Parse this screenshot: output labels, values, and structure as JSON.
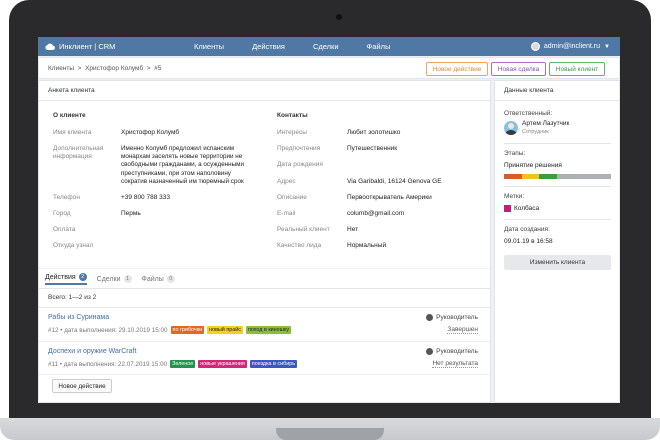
{
  "topbar": {
    "brand": "Инклиент | CRM",
    "nav": [
      "Клиенты",
      "Действия",
      "Сделки",
      "Файлы"
    ],
    "user": "admin@inclient.ru"
  },
  "breadcrumb": "Клиенты  >  Христофор Колумб  >  #5",
  "actions": {
    "new_action": "Новое действие",
    "new_deal": "Новая сделка",
    "new_client": "Новый клиент"
  },
  "profile": {
    "header": "Анкета клиента",
    "about_title": "О клиенте",
    "contacts_title": "Контакты",
    "left": [
      {
        "label": "Имя клиента",
        "value": "Христофор Колумб"
      },
      {
        "label": "Дополнительная информация",
        "value": "Именно Колумб предложил испанским монархам заселять новые территории не свободными гражданами, а осужденными преступниками, при этом наполовину сократив назначенный им тюремный срок"
      },
      {
        "label": "Телефон",
        "value": "+39 800 788 333"
      },
      {
        "label": "Город",
        "value": "Пермь"
      },
      {
        "label": "Оплата",
        "value": ""
      },
      {
        "label": "Откуда узнал",
        "value": ""
      }
    ],
    "right": [
      {
        "label": "Интересы",
        "value": "Любит золотишко"
      },
      {
        "label": "Предпочтения",
        "value": "Путешественник"
      },
      {
        "label": "Дата рождения",
        "value": ""
      },
      {
        "label": "Адрес",
        "value": "Via Garibaldi, 16124 Genova GE"
      },
      {
        "label": "Описание",
        "value": "Первооткрыватель Америки"
      },
      {
        "label": "E-mail",
        "value": "columb@gmail.com"
      },
      {
        "label": "Реальный клиент",
        "value": "Нет"
      },
      {
        "label": "Качество лида",
        "value": "Нормальный"
      }
    ]
  },
  "tabs": [
    {
      "label": "Действия",
      "count": "2"
    },
    {
      "label": "Сделки",
      "count": "1"
    },
    {
      "label": "Файлы",
      "count": "0"
    }
  ],
  "total": "Всего: 1—2 из 2",
  "deals": [
    {
      "title": "Рабы из Суринама",
      "meta": "#12 • дата выполнения: 29.10.2019 15:00",
      "tags": [
        {
          "text": "по грибочки",
          "color": "#e0681f"
        },
        {
          "text": "новый прайс",
          "color": "#f1d21c"
        },
        {
          "text": "поход в киношку",
          "color": "#8dbe3a"
        }
      ],
      "responsible": "Руководитель",
      "status": "Завершен"
    },
    {
      "title": "Доспехи и оружие WarCraft",
      "meta": "#11 • дата выполнения: 22.07.2019 15:00",
      "tags": [
        {
          "text": "Зеленое",
          "color": "#25934b"
        },
        {
          "text": "новые украшения",
          "color": "#d02779"
        },
        {
          "text": "поездка в сибирь",
          "color": "#3c56c2"
        }
      ],
      "responsible": "Руководитель",
      "status": "Нет результата"
    }
  ],
  "add_action": "Новое действие",
  "side": {
    "header": "Данные клиента",
    "resp_label": "Ответственный:",
    "resp_name": "Артем Лазутчик",
    "resp_role": "Сотрудник",
    "stages_label": "Этапы:",
    "stage": "Принятие решения",
    "stage_colors": [
      "#dc5a2a",
      "#f2c31f",
      "#3f9a46",
      "#aeb0b3"
    ],
    "tags_label": "Метки:",
    "tag": "Колбаса",
    "tag_color": "#c61e78",
    "created_label": "Дата создания:",
    "created": "09.01.19 в 16:58",
    "change_btn": "Изменить клиента"
  }
}
